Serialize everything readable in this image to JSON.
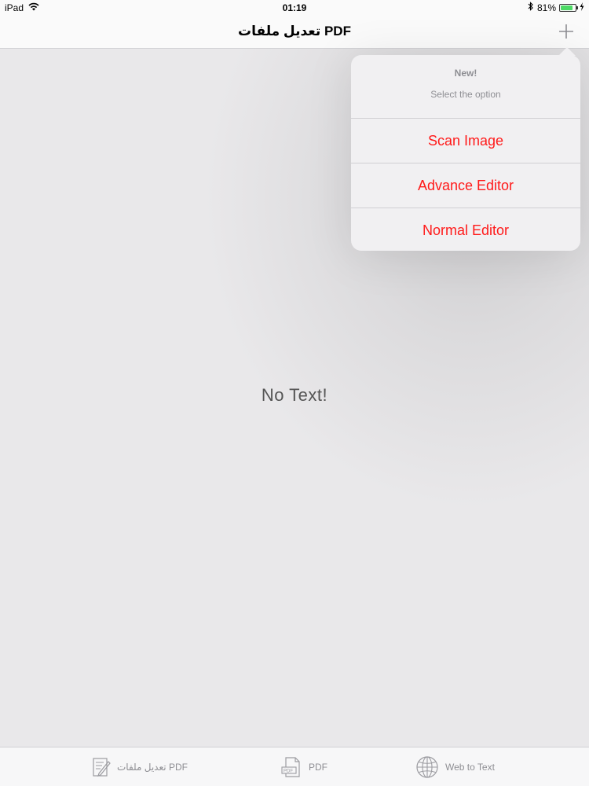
{
  "status_bar": {
    "device": "iPad",
    "time": "01:19",
    "battery_percent": "81%",
    "battery_level": 0.81
  },
  "nav": {
    "title": "تعديل ملفات PDF"
  },
  "content": {
    "empty_message": "No Text!"
  },
  "popover": {
    "title": "New!",
    "subtitle": "Select the option",
    "actions": [
      {
        "label": "Scan Image"
      },
      {
        "label": "Advance Editor"
      },
      {
        "label": "Normal Editor"
      }
    ]
  },
  "tab_bar": {
    "items": [
      {
        "label": "تعديل ملفات PDF",
        "icon": "edit-document-icon"
      },
      {
        "label": "PDF",
        "icon": "pdf-file-icon"
      },
      {
        "label": "Web to Text",
        "icon": "globe-icon"
      }
    ]
  },
  "colors": {
    "action_red": "#ff1a1a",
    "battery_green": "#4cd964",
    "secondary_text": "#8e8e93"
  }
}
